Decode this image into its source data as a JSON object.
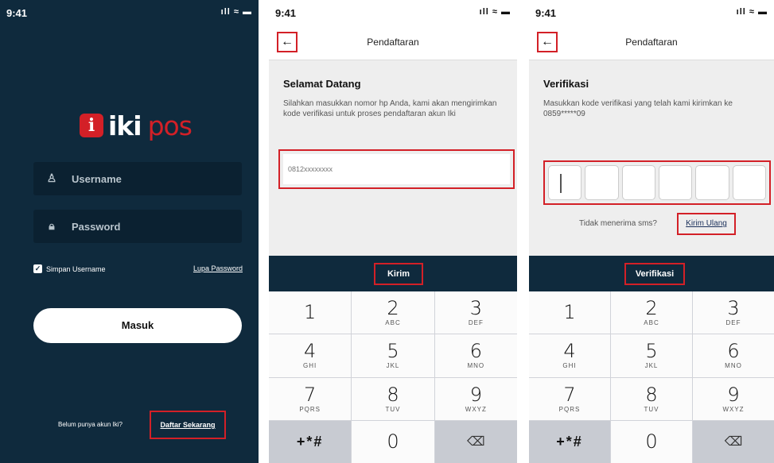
{
  "status": {
    "time": "9:41",
    "signal": "ıll ≈ ▬"
  },
  "login": {
    "logo_badge": "i",
    "logo_iki": "iki",
    "logo_pos": "pos",
    "username_placeholder": "Username",
    "password_placeholder": "Password",
    "remember_label": "Simpan Username",
    "forgot_label": "Lupa Password",
    "login_button": "Masuk",
    "no_account_text": "Belum punya akun Iki?",
    "register_link": "Daftar Sekarang"
  },
  "register": {
    "nav_title": "Pendaftaran",
    "back_glyph": "←",
    "heading": "Selamat Datang",
    "description": "Silahkan masukkan nomor hp Anda, kami akan mengirimkan kode verifikasi untuk proses pendaftaran akun Iki",
    "phone_placeholder": "0812xxxxxxxx",
    "submit_button": "Kirim"
  },
  "verify": {
    "nav_title": "Pendaftaran",
    "back_glyph": "←",
    "heading": "Verifikasi",
    "description": "Masukkan kode verifikasi yang telah kami kirimkan ke 0859*****09",
    "resend_prompt": "Tidak menerima sms?",
    "resend_link": "Kirim Ulang",
    "submit_button": "Verifikasi"
  },
  "keypad": {
    "keys": [
      {
        "num": "1",
        "letters": ""
      },
      {
        "num": "2",
        "letters": "ABC"
      },
      {
        "num": "3",
        "letters": "DEF"
      },
      {
        "num": "4",
        "letters": "GHI"
      },
      {
        "num": "5",
        "letters": "JKL"
      },
      {
        "num": "6",
        "letters": "MNO"
      },
      {
        "num": "7",
        "letters": "PQRS"
      },
      {
        "num": "8",
        "letters": "TUV"
      },
      {
        "num": "9",
        "letters": "WXYZ"
      },
      {
        "num": "0",
        "letters": ""
      }
    ],
    "symbols": "+*#",
    "delete": "⌫"
  },
  "colors": {
    "navy": "#0f2a3d",
    "accent_red": "#d32027"
  }
}
